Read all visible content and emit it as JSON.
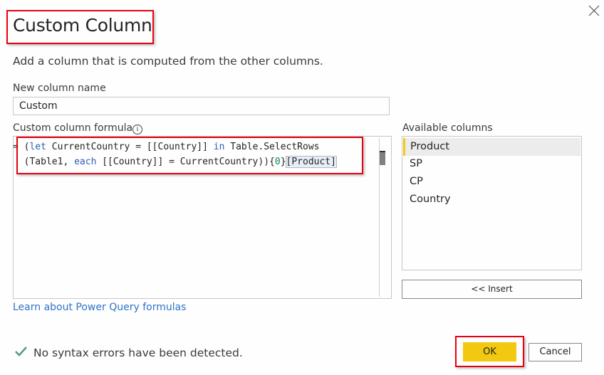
{
  "dialog": {
    "title": "Custom Column",
    "description": "Add a column that is computed from the other columns.",
    "close_icon": "close-icon"
  },
  "new_column": {
    "label": "New column name",
    "value": "Custom"
  },
  "formula": {
    "label": "Custom column formula",
    "info_icon": "info-icon",
    "line1": {
      "t1": "= (",
      "kw1": "let",
      "t2": " CurrentCountry = [[Country]] ",
      "kw2": "in",
      "t3": " Table.SelectRows"
    },
    "line2": {
      "t1": "  (Table1, ",
      "kw1": "each",
      "t2": " [[Country]] = CurrentCountry)){",
      "num": "0",
      "t3": "}",
      "t4": "[Product]"
    }
  },
  "available_columns": {
    "label": "Available columns",
    "items": [
      {
        "label": "Product",
        "selected": true
      },
      {
        "label": "SP",
        "selected": false
      },
      {
        "label": "CP",
        "selected": false
      },
      {
        "label": "Country",
        "selected": false
      }
    ],
    "insert_label": "<< Insert"
  },
  "learn_link": "Learn about Power Query formulas",
  "status": {
    "icon": "checkmark-icon",
    "text": "No syntax errors have been detected.",
    "color": "#5a9a86"
  },
  "buttons": {
    "ok": "OK",
    "cancel": "Cancel"
  },
  "colors": {
    "accent": "#f2c811",
    "annotation": "#e8000f",
    "link": "#2e74c8",
    "keyword": "#2f5fb3"
  }
}
